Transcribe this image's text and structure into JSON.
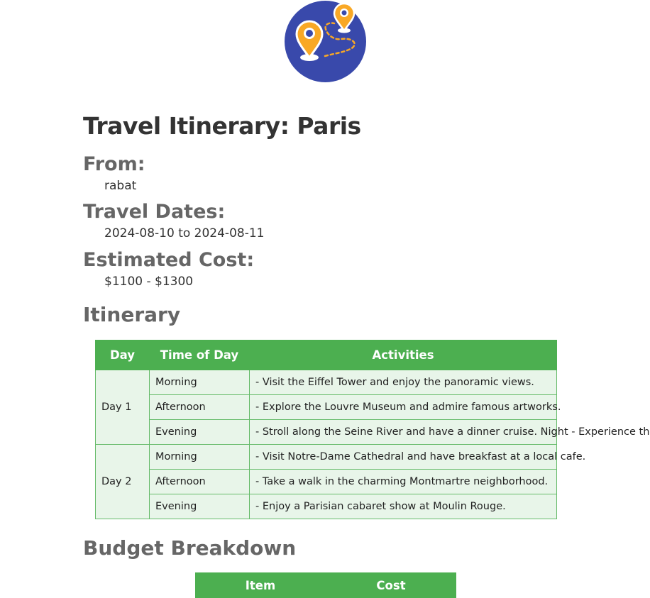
{
  "header": {
    "logo_icon": "map-route-pins-icon",
    "title": "Travel Itinerary: Paris"
  },
  "details": {
    "from_label": "From:",
    "from_value": "rabat",
    "dates_label": "Travel Dates:",
    "dates_value": "2024-08-10 to 2024-08-11",
    "cost_label": "Estimated Cost:",
    "cost_value": "$1100 - $1300"
  },
  "itinerary": {
    "heading": "Itinerary",
    "columns": [
      "Day",
      "Time of Day",
      "Activities"
    ],
    "days": [
      {
        "day": "Day 1",
        "slots": [
          {
            "time": "Morning",
            "activity": "- Visit the Eiffel Tower and enjoy the panoramic views."
          },
          {
            "time": "Afternoon",
            "activity": "- Explore the Louvre Museum and admire famous artworks."
          },
          {
            "time": "Evening",
            "activity": "- Stroll along the Seine River and have a dinner cruise. Night - Experience th"
          }
        ]
      },
      {
        "day": "Day 2",
        "slots": [
          {
            "time": "Morning",
            "activity": "- Visit Notre-Dame Cathedral and have breakfast at a local cafe."
          },
          {
            "time": "Afternoon",
            "activity": "- Take a walk in the charming Montmartre neighborhood."
          },
          {
            "time": "Evening",
            "activity": "- Enjoy a Parisian cabaret show at Moulin Rouge."
          }
        ]
      }
    ]
  },
  "budget": {
    "heading": "Budget Breakdown",
    "columns": [
      "Item",
      "Cost"
    ]
  },
  "colors": {
    "table_header_green": "#4caf50",
    "table_cell_bg": "#e8f5e9",
    "logo_blue": "#3949ab",
    "pin_orange": "#f9a825"
  }
}
